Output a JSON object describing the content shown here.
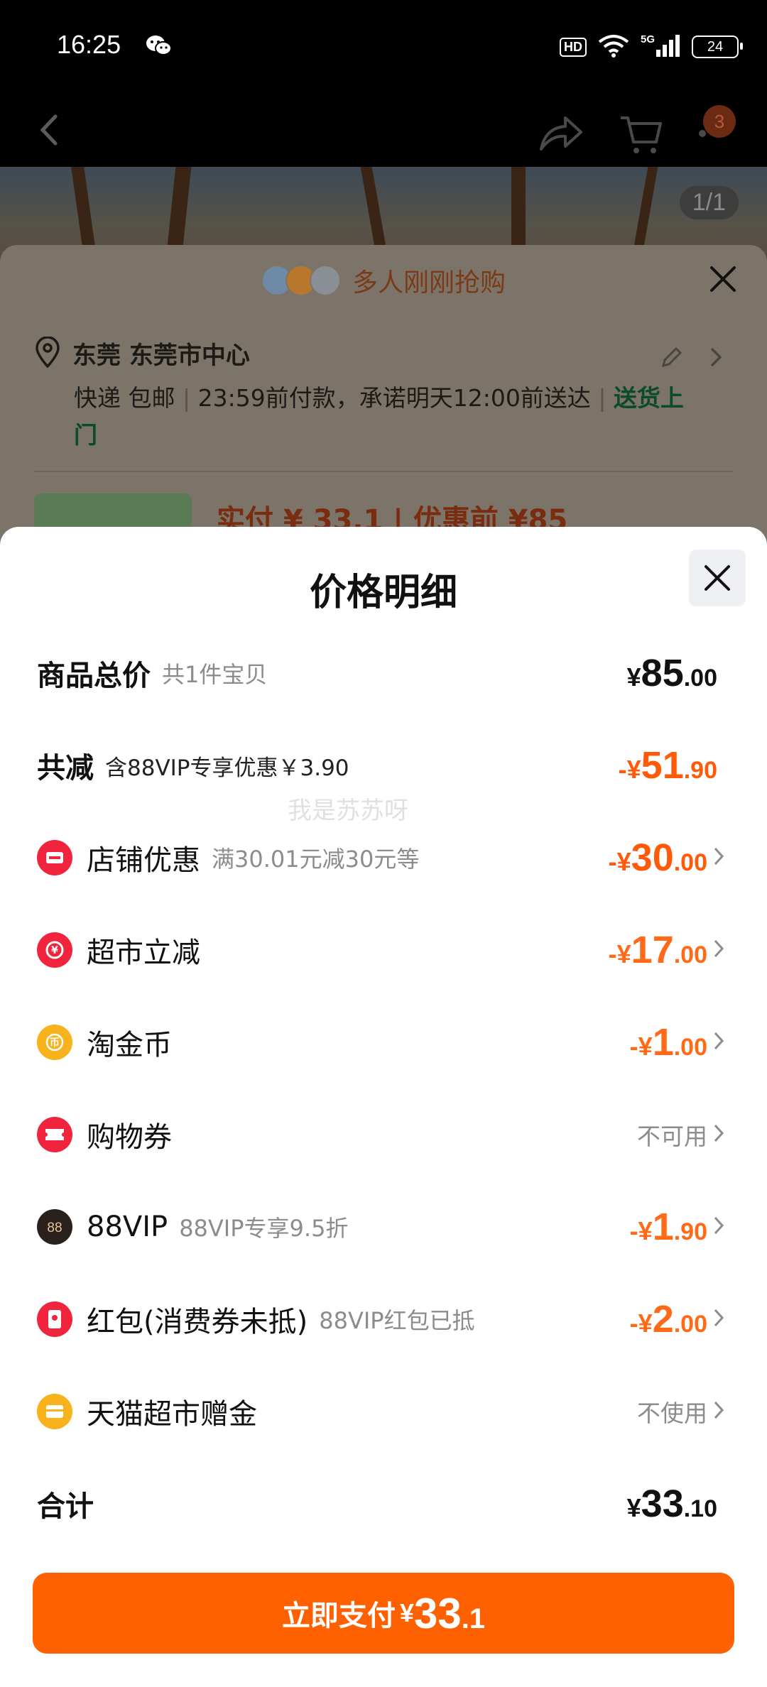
{
  "status_bar": {
    "time": "16:25",
    "hd": "HD",
    "network": "5G",
    "battery": "24"
  },
  "background": {
    "image_counter": "1/1",
    "grab_text": "多人刚刚抢购",
    "address": "东莞 东莞市中心",
    "shipping_prefix": "快递 包邮",
    "shipping_deadline": "23:59前付款，承诺明天12:00前送达",
    "shipping_tag": "送货上门",
    "price_partial": "实付 ¥ 33.1 | 优惠前 ¥85",
    "cart_count": "3"
  },
  "modal": {
    "title": "价格明细",
    "watermark": "我是苏苏呀",
    "total_price": {
      "label": "商品总价",
      "sub": "共1件宝贝",
      "yen": "¥",
      "int": "85",
      "dec": ".00"
    },
    "total_discount": {
      "label": "共减",
      "sub": "含88VIP专享优惠￥3.90",
      "yen": "-¥",
      "int": "51",
      "dec": ".90"
    },
    "items": [
      {
        "label": "店铺优惠",
        "sub": "满30.01元减30元等",
        "yen": "-¥",
        "int": "30",
        "dec": ".00",
        "icon": "shop-coupon-icon",
        "color": "#f0243c"
      },
      {
        "label": "超市立减",
        "sub": "",
        "yen": "-¥",
        "int": "17",
        "dec": ".00",
        "icon": "supermarket-discount-icon",
        "color": "#f0243c"
      },
      {
        "label": "淘金币",
        "sub": "",
        "yen": "-¥",
        "int": "1",
        "dec": ".00",
        "icon": "taojinbi-coin-icon",
        "color": "#f7b21c"
      },
      {
        "label": "购物券",
        "sub": "",
        "status": "不可用",
        "icon": "shopping-voucher-icon",
        "color": "#f0243c"
      },
      {
        "label": "88VIP",
        "sub": "88VIP专享9.5折",
        "yen": "-¥",
        "int": "1",
        "dec": ".90",
        "icon": "88vip-icon",
        "color": "#2a211c"
      },
      {
        "label": "红包(消费券未抵)",
        "sub": "88VIP红包已抵",
        "yen": "-¥",
        "int": "2",
        "dec": ".00",
        "icon": "red-packet-icon",
        "color": "#f0243c"
      },
      {
        "label": "天猫超市赠金",
        "sub": "",
        "status": "不使用",
        "icon": "tmall-gift-money-icon",
        "color": "#f7b21c"
      }
    ],
    "sum": {
      "label": "合计",
      "yen": "¥",
      "int": "33",
      "dec": ".10"
    },
    "pay_button": {
      "label": "立即支付",
      "yen": "¥",
      "int": "33",
      "dec": ".1"
    }
  },
  "colors": {
    "accent_orange": "#ff6000",
    "discount_orange": "#ff5a0a",
    "shop_red": "#f0243c",
    "coin_yellow": "#f7b21c",
    "shipping_green": "#0c4a2c"
  }
}
